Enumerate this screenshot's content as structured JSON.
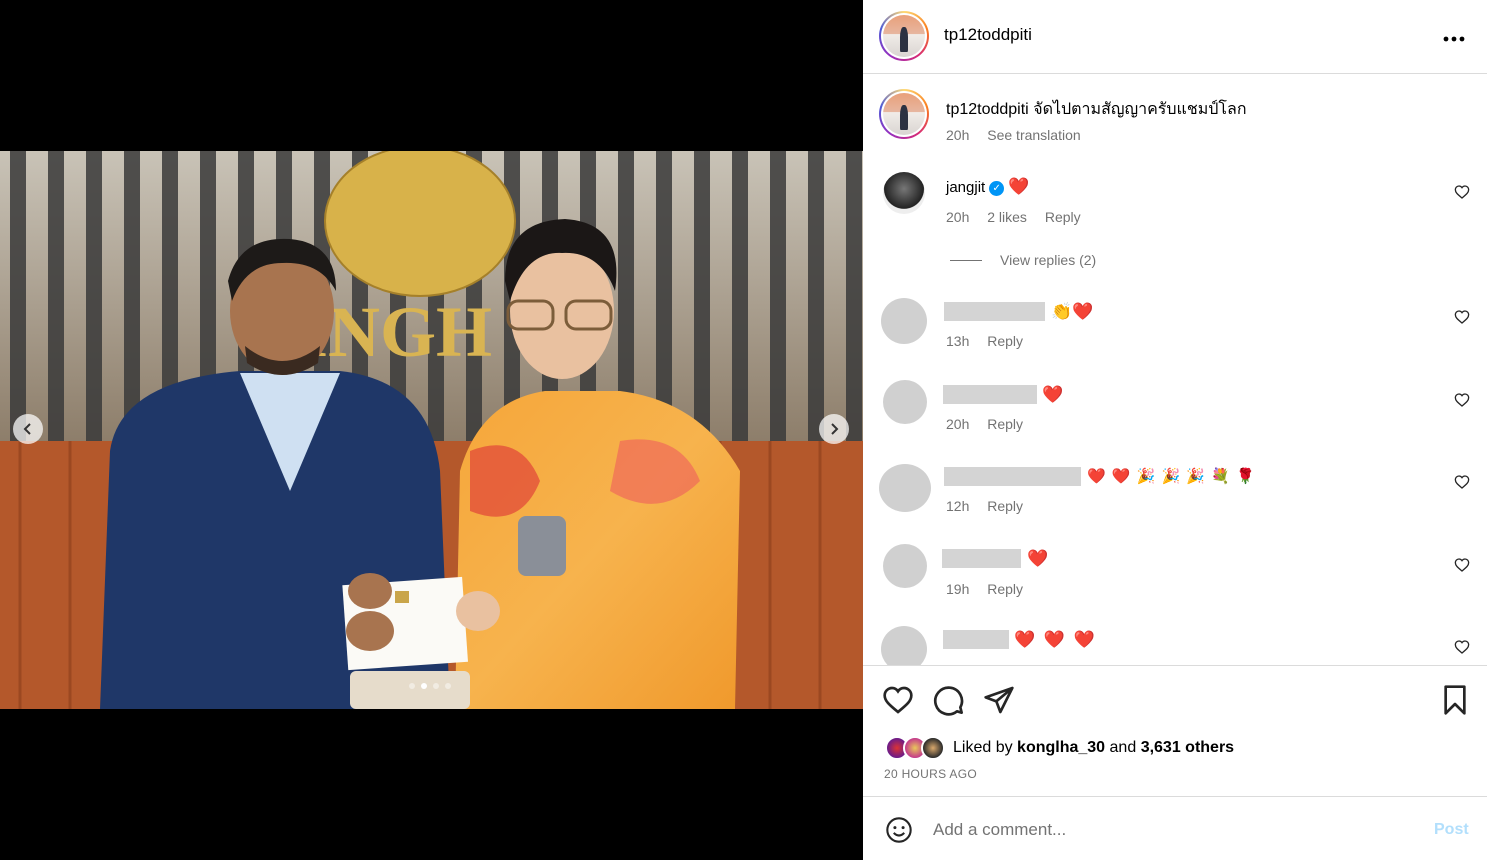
{
  "post": {
    "username": "tp12toddpiti",
    "more_icon": "more-horizontal-icon",
    "carousel": {
      "slide_count": 4,
      "active_index": 1
    }
  },
  "caption": {
    "username": "tp12toddpiti",
    "text": "จัดไปตามสัญญาครับแชมป์โลก",
    "time": "20h",
    "see_translation": "See translation"
  },
  "comments": [
    {
      "username": "jangjit",
      "verified": true,
      "text": "❤️",
      "time": "20h",
      "likes": "2 likes",
      "reply": "Reply",
      "view_replies": "View replies (2)"
    },
    {
      "username": "",
      "text": "👏❤️",
      "time": "13h",
      "reply": "Reply"
    },
    {
      "username": "",
      "text": "❤️",
      "time": "20h",
      "reply": "Reply"
    },
    {
      "username": "",
      "text": "❤️ ❤️ 🎉 🎉 🎉 💐 🌹",
      "time": "12h",
      "reply": "Reply"
    },
    {
      "username": "",
      "text": "❤️",
      "time": "19h",
      "reply": "Reply"
    },
    {
      "username": "",
      "text": "❤️ ❤️ ❤️",
      "time": "",
      "reply": ""
    }
  ],
  "likes": {
    "prefix": "Liked by",
    "user": "konglha_30",
    "and": "and",
    "others": "3,631 others",
    "time_ago": "20 HOURS AGO"
  },
  "composer": {
    "placeholder": "Add a comment...",
    "post_label": "Post"
  },
  "colors": {
    "accent": "#0095f6",
    "heart": "#e4143c",
    "post_disabled": "#b2dffc"
  }
}
